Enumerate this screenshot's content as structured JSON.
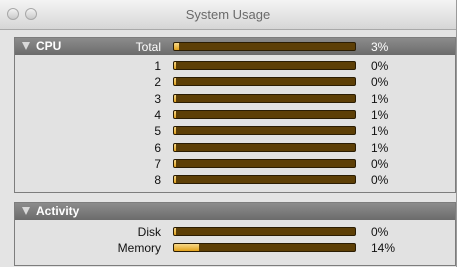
{
  "window": {
    "title": "System Usage"
  },
  "cpu": {
    "title": "CPU",
    "total": {
      "label": "Total",
      "percent": 3,
      "percent_text": "3%"
    },
    "cores": [
      {
        "label": "1",
        "percent": 0,
        "percent_text": "0%"
      },
      {
        "label": "2",
        "percent": 0,
        "percent_text": "0%"
      },
      {
        "label": "3",
        "percent": 1,
        "percent_text": "1%"
      },
      {
        "label": "4",
        "percent": 1,
        "percent_text": "1%"
      },
      {
        "label": "5",
        "percent": 1,
        "percent_text": "1%"
      },
      {
        "label": "6",
        "percent": 1,
        "percent_text": "1%"
      },
      {
        "label": "7",
        "percent": 0,
        "percent_text": "0%"
      },
      {
        "label": "8",
        "percent": 0,
        "percent_text": "0%"
      }
    ]
  },
  "activity": {
    "title": "Activity",
    "rows": [
      {
        "label": "Disk",
        "percent": 0,
        "percent_text": "0%"
      },
      {
        "label": "Memory",
        "percent": 14,
        "percent_text": "14%"
      }
    ]
  }
}
